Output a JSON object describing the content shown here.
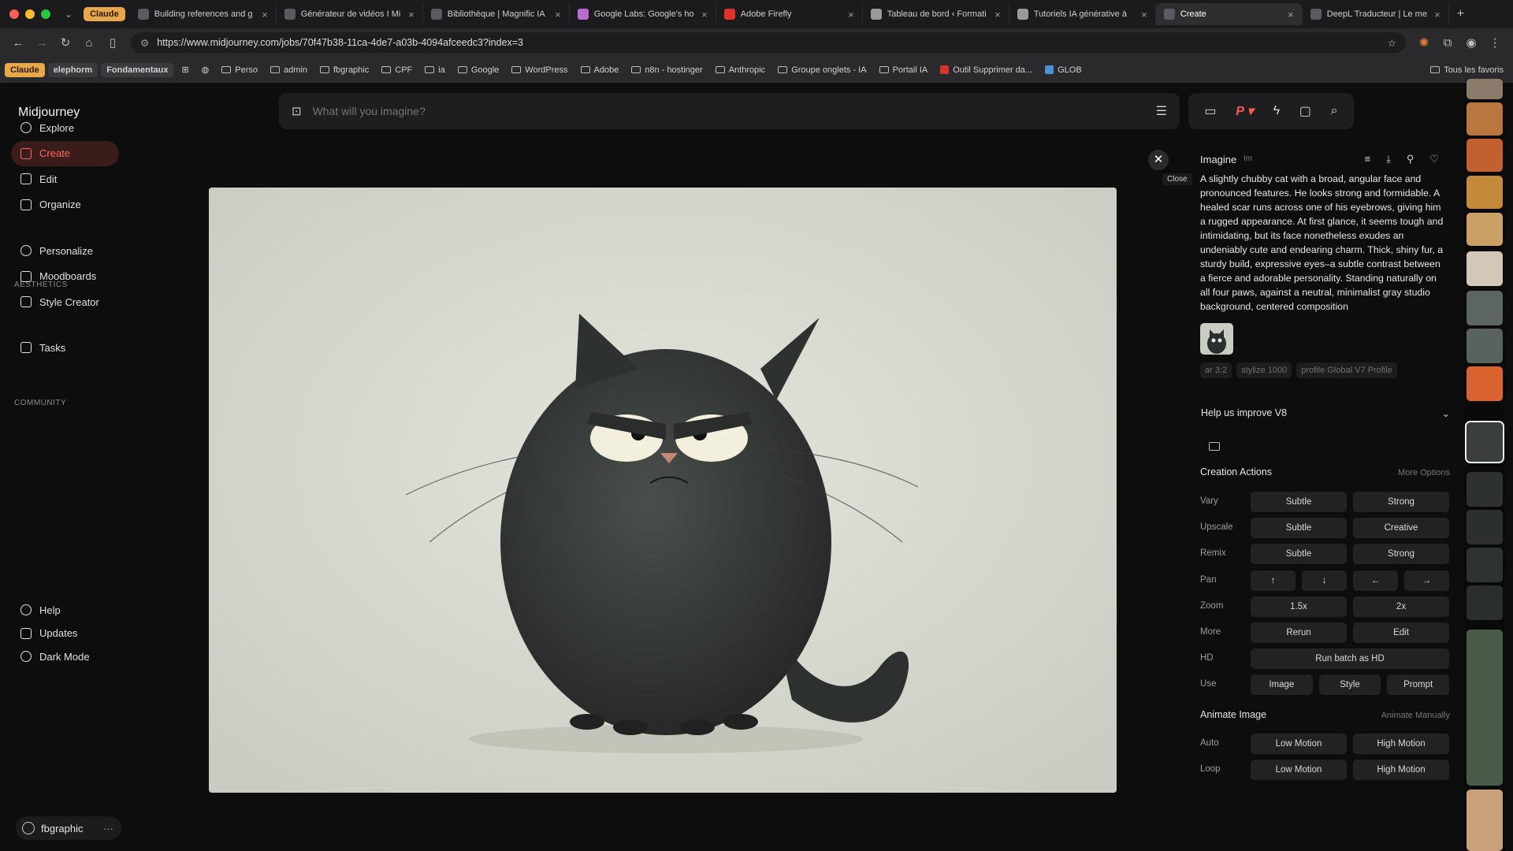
{
  "browser": {
    "group_label": "Claude",
    "tabs": [
      {
        "title": "Building references and g",
        "icon": "midjourney-favicon"
      },
      {
        "title": "Générateur de vidéos I Mi",
        "icon": "midjourney-favicon"
      },
      {
        "title": "Bibliothèque | Magnific IA",
        "icon": "midjourney-favicon"
      },
      {
        "title": "Google Labs: Google's ho",
        "icon": "google-labs-favicon"
      },
      {
        "title": "Adobe Firefly",
        "icon": "adobe-favicon"
      },
      {
        "title": "Tableau de bord ‹ Formati",
        "icon": "wordpress-favicon"
      },
      {
        "title": "Tutoriels IA générative à",
        "icon": "wordpress-favicon"
      },
      {
        "title": "Create",
        "icon": "page-favicon",
        "active": true
      },
      {
        "title": "DeepL Traducteur | Le me",
        "icon": "deepl-favicon"
      }
    ],
    "url": "https://www.midjourney.com/jobs/70f47b38-11ca-4de7-a03b-4094afceedc3?index=3",
    "bookmarks": [
      {
        "label": "Claude",
        "chip": "orange"
      },
      {
        "label": "elephorm",
        "chip": "grey"
      },
      {
        "label": "Fondamentaux",
        "chip": "grey"
      },
      {
        "label": "Perso",
        "folder": true
      },
      {
        "label": "admin",
        "folder": true
      },
      {
        "label": "fbgraphic",
        "folder": true
      },
      {
        "label": "CPF",
        "folder": true
      },
      {
        "label": "ia",
        "folder": true
      },
      {
        "label": "Google",
        "folder": true
      },
      {
        "label": "WordPress",
        "folder": true
      },
      {
        "label": "Adobe",
        "folder": true
      },
      {
        "label": "n8n - hostinger",
        "folder": true
      },
      {
        "label": "Anthropic",
        "folder": true
      },
      {
        "label": "Groupe onglets - IA",
        "folder": true
      },
      {
        "label": "Portail IA",
        "folder": true
      },
      {
        "label": "Outil Supprimer da...",
        "folder": false
      },
      {
        "label": "GLOB",
        "folder": false
      }
    ],
    "all_bookmarks": "Tous les favoris"
  },
  "sidebar": {
    "logo": "Midjourney",
    "items": [
      {
        "label": "Explore",
        "icon": "compass-icon"
      },
      {
        "label": "Create",
        "icon": "brush-icon",
        "active": true
      },
      {
        "label": "Edit",
        "icon": "edit-icon"
      },
      {
        "label": "Organize",
        "icon": "grid-icon"
      }
    ],
    "aesthetics_heading": "AESTHETICS",
    "aesthetics_items": [
      {
        "label": "Personalize",
        "icon": "personalize-icon"
      },
      {
        "label": "Moodboards",
        "icon": "moodboard-icon"
      },
      {
        "label": "Style Creator",
        "icon": "style-creator-icon"
      }
    ],
    "community_heading": "COMMUNITY",
    "community_items": [
      {
        "label": "Tasks",
        "icon": "thumbs-up-icon"
      }
    ],
    "bottom_items": [
      {
        "label": "Help",
        "icon": "help-icon"
      },
      {
        "label": "Updates",
        "icon": "bell-icon"
      },
      {
        "label": "Dark Mode",
        "icon": "moon-icon"
      }
    ],
    "user": "fbgraphic"
  },
  "search": {
    "placeholder": "What will you imagine?"
  },
  "viewer": {
    "close_tooltip": "Close"
  },
  "panel": {
    "title": "Imagine",
    "tag": "Im",
    "prompt": "A slightly chubby cat with a broad, angular face and pronounced features. He looks strong and formidable. A healed scar runs across one of his eyebrows, giving him a rugged appearance. At first glance, it seems tough and intimidating, but its face nonetheless exudes an undeniably cute and endearing charm. Thick, shiny fur, a sturdy build, expressive eyes–a subtle contrast between a fierce and adorable personality. Standing naturally on all four paws, against a neutral, minimalist gray studio background, centered composition",
    "params": [
      "ar 3:2",
      "stylize 1000",
      "profile Global V7 Profile"
    ],
    "help_title": "Help us improve V8",
    "creation_title": "Creation Actions",
    "more_options": "More Options",
    "rows": [
      {
        "label": "Vary",
        "buttons": [
          "Subtle",
          "Strong"
        ]
      },
      {
        "label": "Upscale",
        "buttons": [
          "Subtle",
          "Creative"
        ]
      },
      {
        "label": "Remix",
        "buttons": [
          "Subtle",
          "Strong"
        ]
      },
      {
        "label": "Pan",
        "buttons": [
          "↑",
          "↓",
          "←",
          "→"
        ]
      },
      {
        "label": "Zoom",
        "buttons": [
          "1.5x",
          "2x"
        ]
      },
      {
        "label": "More",
        "buttons": [
          "Rerun",
          "Edit"
        ]
      },
      {
        "label": "HD",
        "buttons": [
          "Run batch as HD"
        ]
      },
      {
        "label": "Use",
        "buttons": [
          "Image",
          "Style",
          "Prompt"
        ]
      }
    ],
    "animate_title": "Animate Image",
    "animate_manual": "Animate Manually",
    "animate_rows": [
      {
        "label": "Auto",
        "buttons": [
          "Low Motion",
          "High Motion"
        ]
      },
      {
        "label": "Loop",
        "buttons": [
          "Low Motion",
          "High Motion"
        ]
      }
    ]
  }
}
